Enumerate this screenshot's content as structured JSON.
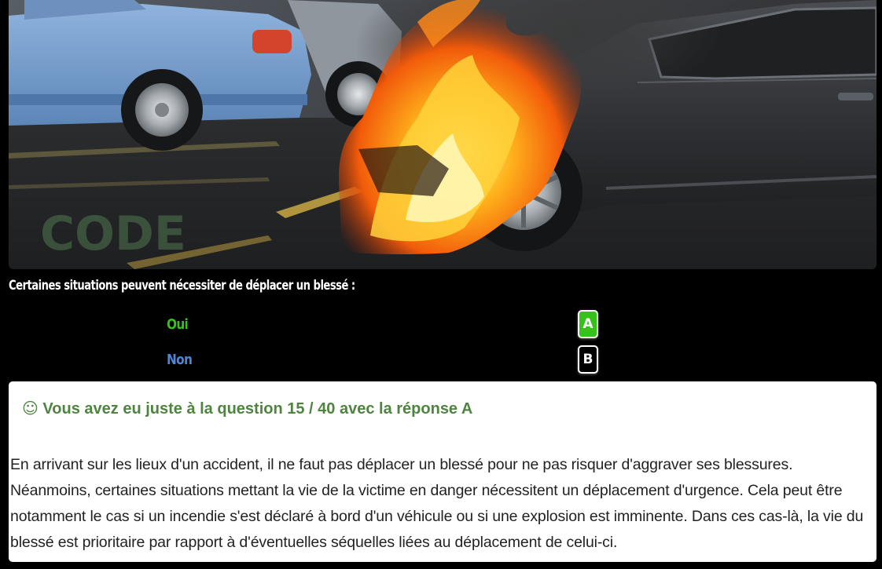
{
  "photo": {
    "watermark": "CODE"
  },
  "question": {
    "text": "Certaines situations peuvent nécessiter de déplacer un blessé :"
  },
  "answers": [
    {
      "text": "Oui",
      "key": "A",
      "color": "#37c21b",
      "selected": true
    },
    {
      "text": "Non",
      "key": "B",
      "color": "#4b86d8",
      "selected": false
    }
  ],
  "result": {
    "icon": "☺",
    "title": "Vous avez eu juste à la question 15 / 40 avec la réponse A",
    "title_color": "#4f8440",
    "explanation": "En arrivant sur les lieux d'un accident, il ne faut pas déplacer un blessé pour ne pas risquer d'aggraver ses blessures. Néanmoins, certaines situations mettant la vie de la victime en danger nécessitent un déplacement d'urgence. Cela peut être notamment le cas si un incendie s'est déclaré à bord d'un véhicule ou si une explosion est imminente. Dans ces cas-là, la vie du blessé est prioritaire par rapport à d'éventuelles séquelles liées au déplacement de celui-ci."
  }
}
